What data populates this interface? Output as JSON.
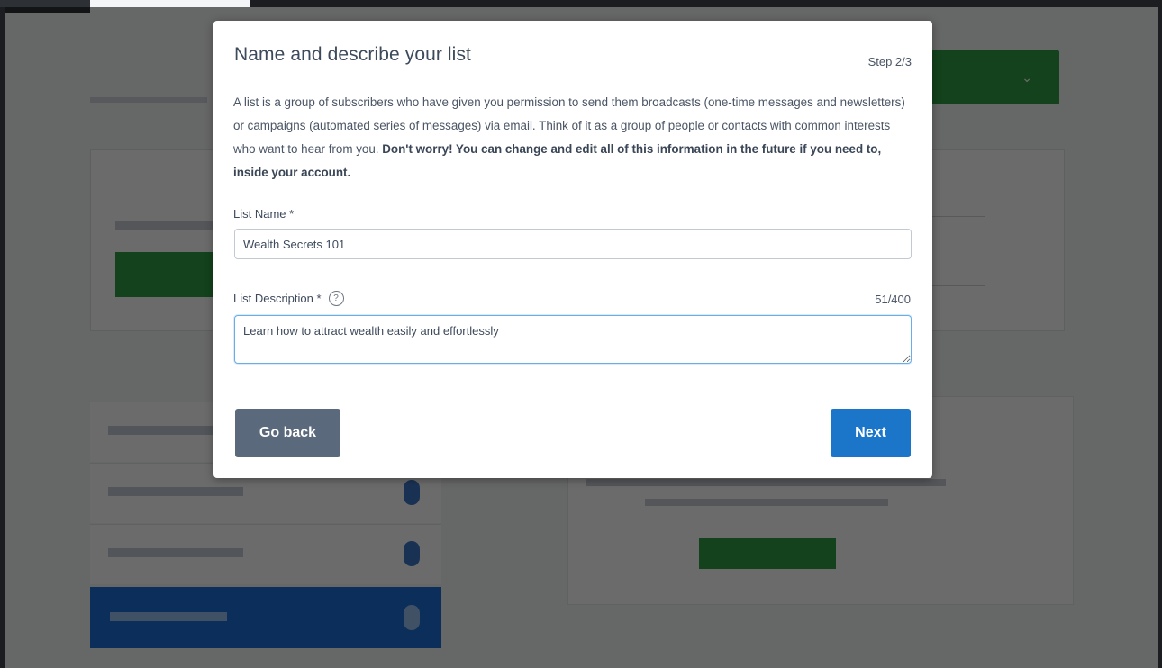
{
  "modal": {
    "title": "Name and describe your list",
    "step": "Step 2/3",
    "description": "A list is a group of subscribers who have given you permission to send them broadcasts (one-time messages and newsletters) or campaigns (automated series of messages) via email. Think of it as a group of people or contacts with common interests who want to hear from you.",
    "description_bold": "Don't worry! You can change and edit all of this information in the future if you need to, inside your account.",
    "list_name": {
      "label": "List Name *",
      "value": "Wealth Secrets 101"
    },
    "list_description": {
      "label": "List Description *",
      "help_icon": "question-circle-icon",
      "help_glyph": "?",
      "counter": "51/400",
      "value": "Learn how to attract wealth easily and effortlessly"
    },
    "buttons": {
      "back": "Go back",
      "next": "Next"
    }
  },
  "colors": {
    "overlay": "#000000",
    "next_button": "#1b75c8",
    "back_button": "#5a6a7c",
    "focus_border": "#6aaee8",
    "background_green": "#2f9e44",
    "background_blue": "#1d6ed6"
  }
}
